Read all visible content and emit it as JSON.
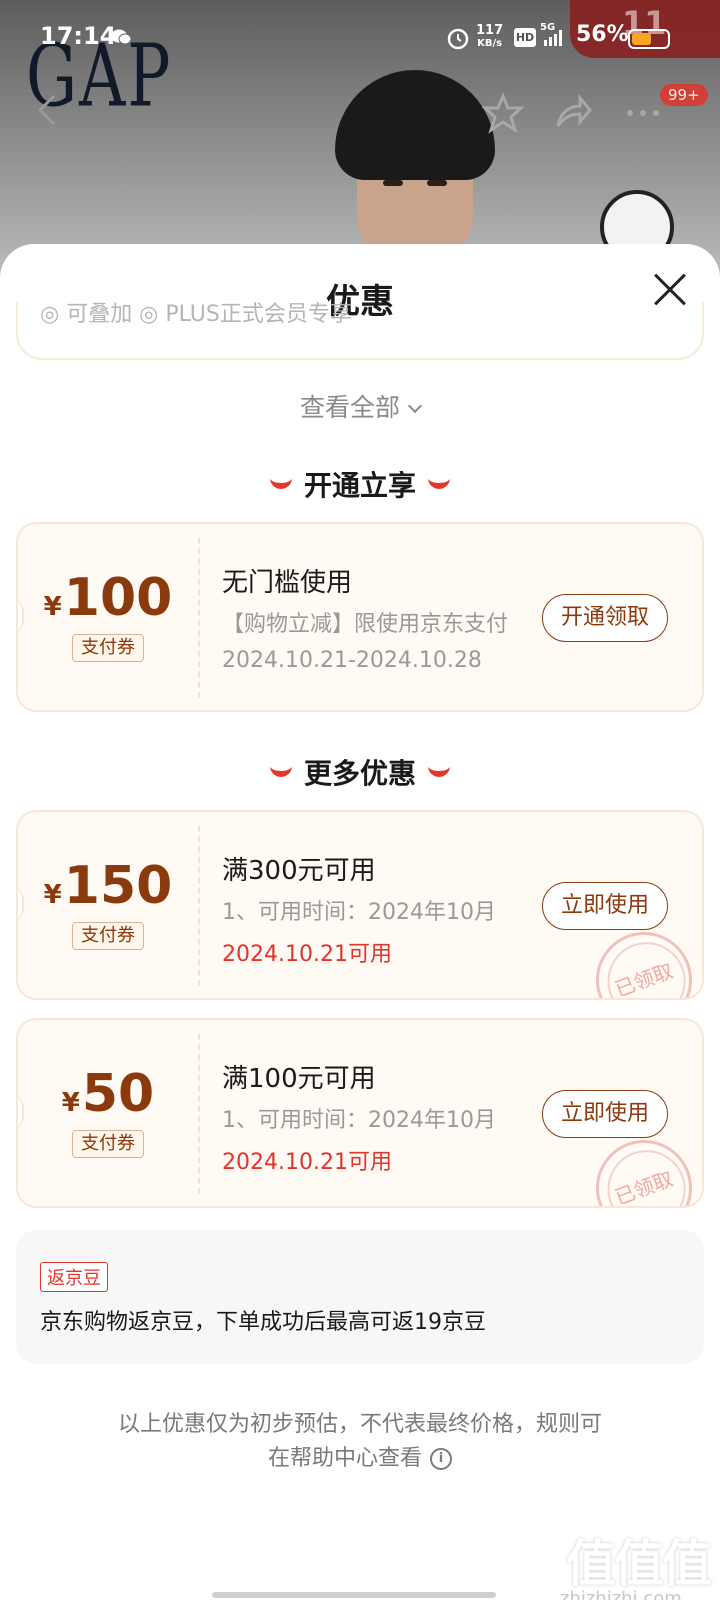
{
  "status_bar": {
    "time": "17:14",
    "net_speed_value": "117",
    "net_speed_unit": "KB/s",
    "hd_label": "HD",
    "network": "5G",
    "battery_pct": "56%",
    "battery_level": 0.56,
    "icons": [
      "wechat-icon",
      "alarm-icon",
      "signal-icon",
      "battery-icon"
    ]
  },
  "background_page": {
    "brand_logo": "GAP",
    "cart_badge": "99+",
    "sale_tag": "11",
    "icons": [
      "back-icon",
      "star-icon",
      "share-icon",
      "more-icon"
    ]
  },
  "sheet": {
    "title": "优惠",
    "peek_text": "◎ 可叠加  ◎ PLUS正式会员专享",
    "view_all": "查看全部",
    "section1_title": "开通立享",
    "section2_title": "更多优惠",
    "coupons_section1": [
      {
        "currency": "¥",
        "amount": "100",
        "type": "支付券",
        "title": "无门槛使用",
        "desc": "【购物立减】限使用京东支付",
        "date": "2024.10.21-2024.10.28",
        "button": "开通领取"
      }
    ],
    "coupons_section2": [
      {
        "currency": "¥",
        "amount": "150",
        "type": "支付券",
        "title": "满300元可用",
        "desc": "1、可用时间：2024年10月",
        "date": "2024.10.21可用",
        "button": "立即使用",
        "stamp": "已领取"
      },
      {
        "currency": "¥",
        "amount": "50",
        "type": "支付券",
        "title": "满100元可用",
        "desc": "1、可用时间：2024年10月",
        "date": "2024.10.21可用",
        "button": "立即使用",
        "stamp": "已领取"
      }
    ],
    "bean": {
      "tag": "返京豆",
      "text": "京东购物返京豆，下单成功后最高可返19京豆"
    },
    "footnote_line1": "以上优惠仅为初步预估，不代表最终价格，规则可",
    "footnote_line2": "在帮助中心查看"
  },
  "watermark": {
    "text": "值值值",
    "url": "zhizhizhi.com"
  },
  "colors": {
    "accent_red": "#e0352b",
    "coupon_brown": "#8b3a0d",
    "coupon_bg": "#fffaf4"
  }
}
